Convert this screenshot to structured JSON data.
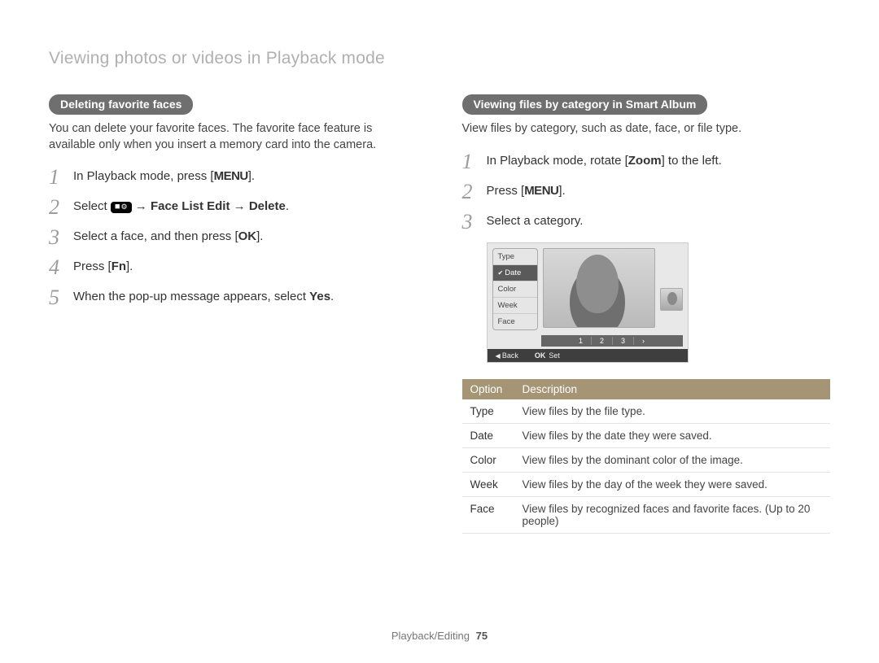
{
  "page_title": "Viewing photos or videos in Playback mode",
  "left": {
    "pill": "Deleting favorite faces",
    "intro": "You can delete your favorite faces. The favorite face feature is available only when you insert a memory card into the camera.",
    "steps": {
      "s1_a": "In Playback mode, press [",
      "s1_menu": "MENU",
      "s1_b": "].",
      "s2_a": "Select ",
      "s2_b": " → ",
      "s2_c": "Face List Edit",
      "s2_d": " → ",
      "s2_e": "Delete",
      "s2_f": ".",
      "s3_a": "Select a face, and then press [",
      "s3_ok": "OK",
      "s3_b": "].",
      "s4_a": "Press [",
      "s4_fn": "Fn",
      "s4_b": "].",
      "s5_a": "When the pop-up message appears, select ",
      "s5_yes": "Yes",
      "s5_b": "."
    }
  },
  "right": {
    "pill": "Viewing files by category in Smart Album",
    "intro": "View files by category, such as date, face, or file type.",
    "steps": {
      "s1_a": "In Playback mode, rotate [",
      "s1_zoom": "Zoom",
      "s1_b": "] to the left.",
      "s2_a": "Press [",
      "s2_menu": "MENU",
      "s2_b": "].",
      "s3": "Select a category."
    },
    "screen": {
      "categories": [
        "Type",
        "Date",
        "Color",
        "Week",
        "Face"
      ],
      "selected": "Date",
      "pager": [
        "1",
        "2",
        "3",
        "›"
      ],
      "footer_back": "Back",
      "footer_set_label": "OK",
      "footer_set": "Set"
    },
    "table": {
      "head_option": "Option",
      "head_desc": "Description",
      "rows": [
        {
          "opt": "Type",
          "desc": "View files by the file type."
        },
        {
          "opt": "Date",
          "desc": "View files by the date they were saved."
        },
        {
          "opt": "Color",
          "desc": "View files by the dominant color of the image."
        },
        {
          "opt": "Week",
          "desc": "View files by the day of the week they were saved."
        },
        {
          "opt": "Face",
          "desc": "View files by recognized faces and favorite faces. (Up to 20 people)"
        }
      ]
    }
  },
  "footer": {
    "section": "Playback/Editing",
    "page": "75"
  }
}
